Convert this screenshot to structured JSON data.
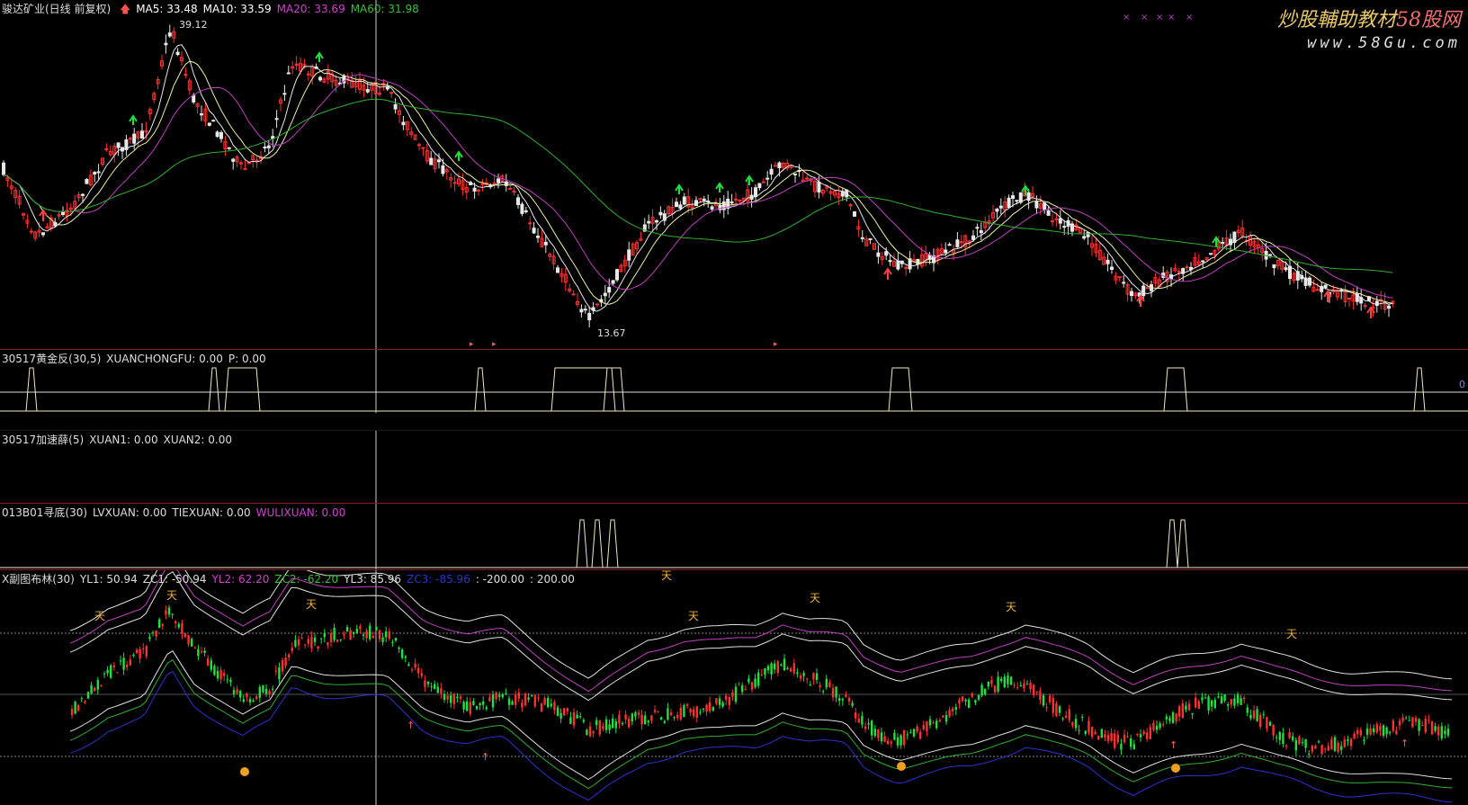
{
  "main": {
    "title": "骏达矿业(日线 前复权)",
    "ma": [
      {
        "label": "MA5: 33.48",
        "color": "#ffffff"
      },
      {
        "label": "MA10: 33.59",
        "color": "#ffffff"
      },
      {
        "label": "MA20: 33.69",
        "color": "#d040d0"
      },
      {
        "label": "MA60: 31.98",
        "color": "#38c038"
      }
    ],
    "high_label": "39.12",
    "low_label": "13.67"
  },
  "watermark": {
    "line1_a": "炒股輔助教材",
    "line1_b": "58股网",
    "line2": "www.58Gu.com"
  },
  "panel1": {
    "items": [
      {
        "label": "30517黄金反(30,5)",
        "color": "#dddddd"
      },
      {
        "label": "XUANCHONGFU: 0.00",
        "color": "#dddddd"
      },
      {
        "label": "P: 0.00",
        "color": "#dddddd"
      }
    ],
    "side_label": "0"
  },
  "panel2": {
    "items": [
      {
        "label": "30517加速薛(5)",
        "color": "#dddddd"
      },
      {
        "label": "XUAN1: 0.00",
        "color": "#dddddd"
      },
      {
        "label": "XUAN2: 0.00",
        "color": "#dddddd"
      }
    ]
  },
  "panel3": {
    "items": [
      {
        "label": "013B01寻底(30)",
        "color": "#dddddd"
      },
      {
        "label": "LVXUAN: 0.00",
        "color": "#dddddd"
      },
      {
        "label": "TIEXUAN: 0.00",
        "color": "#dddddd"
      },
      {
        "label": "WULIXUAN: 0.00",
        "color": "#d040d0"
      }
    ]
  },
  "panel4": {
    "items": [
      {
        "label": "X副图布林(30)",
        "color": "#dddddd"
      },
      {
        "label": "YL1: 50.94",
        "color": "#dddddd"
      },
      {
        "label": "ZC1: -50.94",
        "color": "#dddddd"
      },
      {
        "label": "YL2: 62.20",
        "color": "#d040d0"
      },
      {
        "label": "ZC2: -62.20",
        "color": "#38c038"
      },
      {
        "label": "YL3: 85.96",
        "color": "#dddddd"
      },
      {
        "label": "ZC3: -85.96",
        "color": "#3030d0"
      },
      {
        "label": ": -200.00",
        "color": "#dddddd"
      },
      {
        "label": ": 200.00",
        "color": "#dddddd"
      }
    ]
  },
  "colors": {
    "up": "#ff3030",
    "down": "#20e040",
    "ma_white": "#e8e8e8",
    "ma_purple": "#c040c0",
    "ma_green": "#30b030",
    "separator": "#8a1a2a",
    "signal": "#f0e8c0"
  }
}
